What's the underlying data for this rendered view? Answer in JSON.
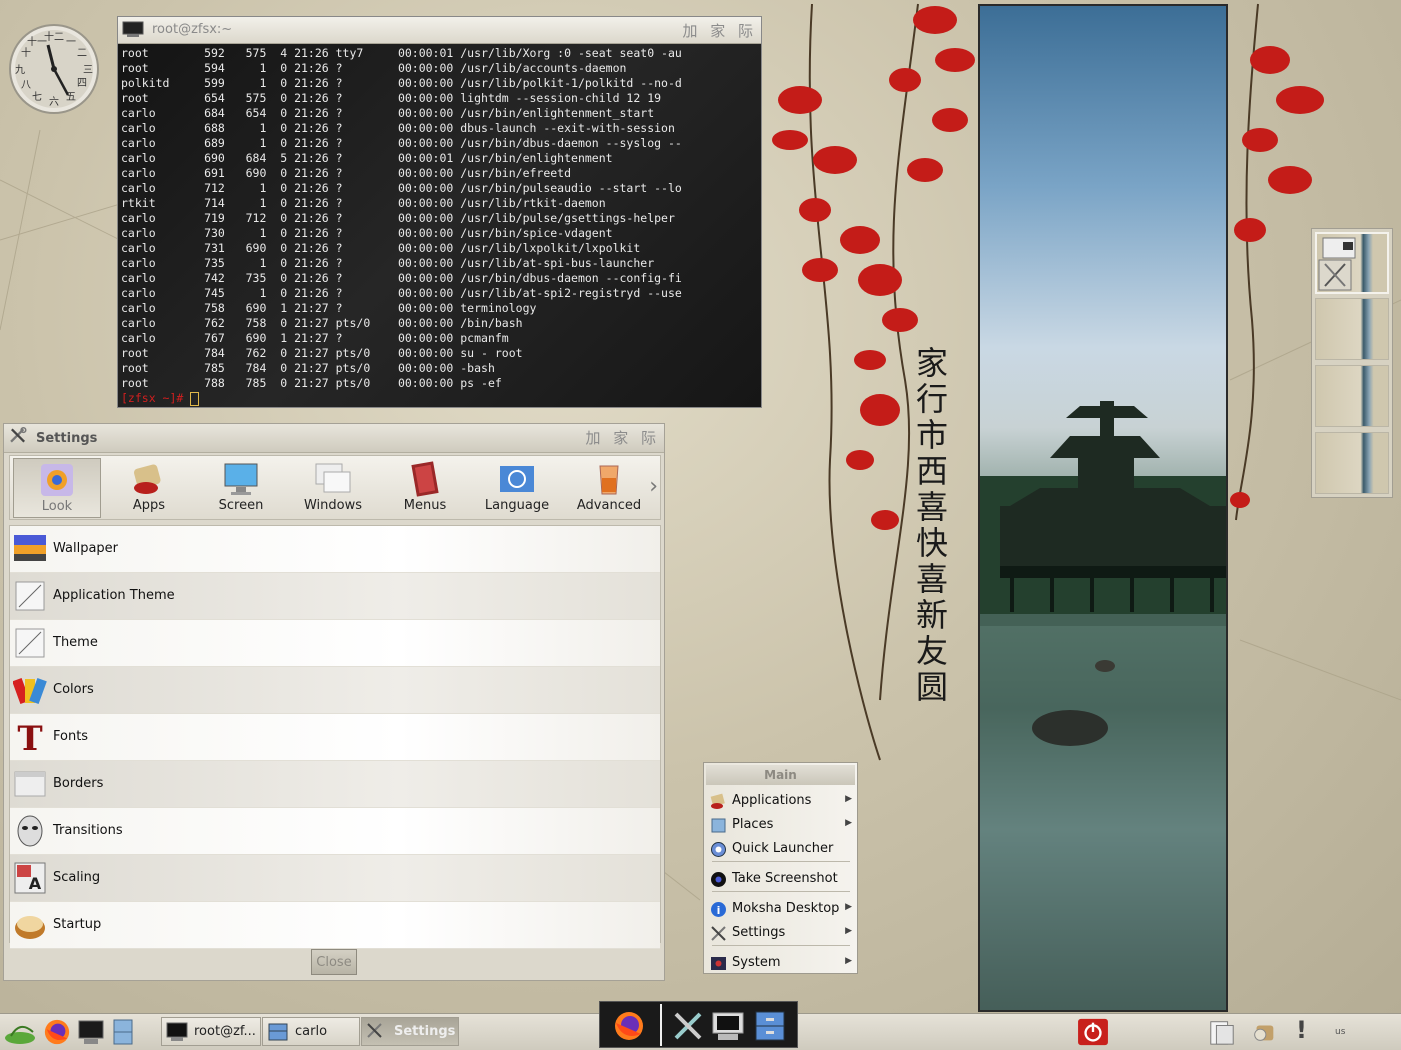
{
  "desktop": {
    "calligraphy": "家行市西喜快喜新友圆"
  },
  "terminal": {
    "title": "root@zfsx:~",
    "title_controls": "加 家 际",
    "lines": [
      "root        592   575  4 21:26 tty7     00:00:01 /usr/lib/Xorg :0 -seat seat0 -au",
      "root        594     1  0 21:26 ?        00:00:00 /usr/lib/accounts-daemon",
      "polkitd     599     1  0 21:26 ?        00:00:00 /usr/lib/polkit-1/polkitd --no-d",
      "root        654   575  0 21:26 ?        00:00:00 lightdm --session-child 12 19",
      "carlo       684   654  0 21:26 ?        00:00:00 /usr/bin/enlightenment_start",
      "carlo       688     1  0 21:26 ?        00:00:00 dbus-launch --exit-with-session",
      "carlo       689     1  0 21:26 ?        00:00:00 /usr/bin/dbus-daemon --syslog --",
      "carlo       690   684  5 21:26 ?        00:00:01 /usr/bin/enlightenment",
      "carlo       691   690  0 21:26 ?        00:00:00 /usr/bin/efreetd",
      "carlo       712     1  0 21:26 ?        00:00:00 /usr/bin/pulseaudio --start --lo",
      "rtkit       714     1  0 21:26 ?        00:00:00 /usr/lib/rtkit-daemon",
      "carlo       719   712  0 21:26 ?        00:00:00 /usr/lib/pulse/gsettings-helper",
      "carlo       730     1  0 21:26 ?        00:00:00 /usr/bin/spice-vdagent",
      "carlo       731   690  0 21:26 ?        00:00:00 /usr/lib/lxpolkit/lxpolkit",
      "carlo       735     1  0 21:26 ?        00:00:00 /usr/lib/at-spi-bus-launcher",
      "carlo       742   735  0 21:26 ?        00:00:00 /usr/bin/dbus-daemon --config-fi",
      "carlo       745     1  0 21:26 ?        00:00:00 /usr/lib/at-spi2-registryd --use",
      "carlo       758   690  1 21:27 ?        00:00:00 terminology",
      "carlo       762   758  0 21:27 pts/0    00:00:00 /bin/bash",
      "carlo       767   690  1 21:27 ?        00:00:00 pcmanfm",
      "root        784   762  0 21:27 pts/0    00:00:00 su - root",
      "root        785   784  0 21:27 pts/0    00:00:00 -bash",
      "root        788   785  0 21:27 pts/0    00:00:00 ps -ef"
    ],
    "prompt": "[zfsx ~]# "
  },
  "settings": {
    "title": "Settings",
    "title_controls": "加 家 际",
    "tabs": [
      {
        "label": "Look",
        "icon": "look-icon"
      },
      {
        "label": "Apps",
        "icon": "apps-icon"
      },
      {
        "label": "Screen",
        "icon": "screen-icon"
      },
      {
        "label": "Windows",
        "icon": "windows-icon"
      },
      {
        "label": "Menus",
        "icon": "menus-icon"
      },
      {
        "label": "Language",
        "icon": "language-icon"
      },
      {
        "label": "Advanced",
        "icon": "advanced-icon"
      }
    ],
    "active_tab": "Look",
    "items": [
      {
        "label": "Wallpaper",
        "icon": "wallpaper-icon"
      },
      {
        "label": "Application Theme",
        "icon": "application-theme-icon"
      },
      {
        "label": "Theme",
        "icon": "theme-icon"
      },
      {
        "label": "Colors",
        "icon": "colors-icon"
      },
      {
        "label": "Fonts",
        "icon": "fonts-icon"
      },
      {
        "label": "Borders",
        "icon": "borders-icon"
      },
      {
        "label": "Transitions",
        "icon": "transitions-icon"
      },
      {
        "label": "Scaling",
        "icon": "scaling-icon"
      },
      {
        "label": "Startup",
        "icon": "startup-icon"
      }
    ],
    "close_label": "Close"
  },
  "main_menu": {
    "header": "Main",
    "items": [
      {
        "label": "Applications",
        "icon": "applications-icon",
        "submenu": true
      },
      {
        "label": "Places",
        "icon": "places-icon",
        "submenu": true
      },
      {
        "label": "Quick Launcher",
        "icon": "quick-launcher-icon",
        "submenu": false
      },
      {
        "label": "Take Screenshot",
        "icon": "screenshot-icon",
        "submenu": false
      },
      {
        "label": "Moksha Desktop",
        "icon": "info-icon",
        "submenu": true
      },
      {
        "label": "Settings",
        "icon": "settings-icon",
        "submenu": true
      },
      {
        "label": "System",
        "icon": "system-icon",
        "submenu": true
      }
    ],
    "arrow": "▶"
  },
  "taskbar": {
    "tasks": [
      {
        "label": "root@zf...",
        "icon": "terminal-icon",
        "active": false
      },
      {
        "label": "carlo",
        "icon": "file-manager-icon",
        "active": false
      },
      {
        "label": "Settings",
        "icon": "settings-icon",
        "active": true
      }
    ],
    "keyboard_layout": "us",
    "alert": "!"
  },
  "colors": {
    "terminal_bg": "#1b1b1b",
    "prompt": "#d11f1f",
    "accent_red": "#c8201c"
  }
}
